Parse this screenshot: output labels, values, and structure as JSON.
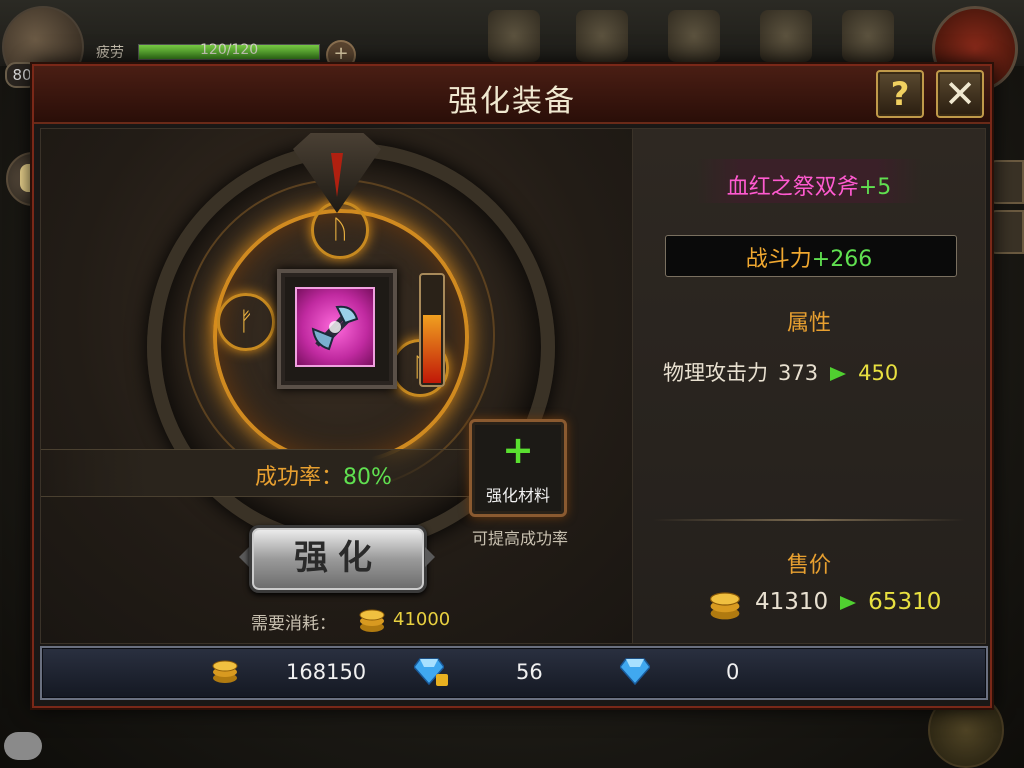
{
  "hud": {
    "level": "80",
    "fatigue_label": "疲劳",
    "fatigue_value": "120/120",
    "fatigue_fraction": 1.0,
    "add_label": "+"
  },
  "dialog": {
    "title": "强化装备",
    "help_label": "?",
    "close_label": "✕"
  },
  "enhance": {
    "success_label": "成功率：",
    "success_value": "80%",
    "material_plus": "+",
    "material_label": "强化材料",
    "material_hint": "可提高成功率",
    "button_label": "强化",
    "cost_label": "需要消耗：",
    "cost_value": "41000",
    "progress_fraction": 0.62,
    "item_rarity_color": "#e040c0"
  },
  "details": {
    "item_name": "血红之祭双斧",
    "item_plus": "+5",
    "power_label": "战斗力",
    "power_value": "+266",
    "attr_title": "属性",
    "attr_name": "物理攻击力",
    "attr_old": "373",
    "attr_new": "450",
    "sell_title": "售价",
    "sell_old": "41310",
    "sell_new": "65310"
  },
  "currency": {
    "gold": "168150",
    "bound_gems": "56",
    "gems": "0"
  },
  "icons": {
    "coin": "gold-coin-stack-icon",
    "bound_gem": "locked-diamond-icon",
    "gem": "diamond-icon"
  }
}
